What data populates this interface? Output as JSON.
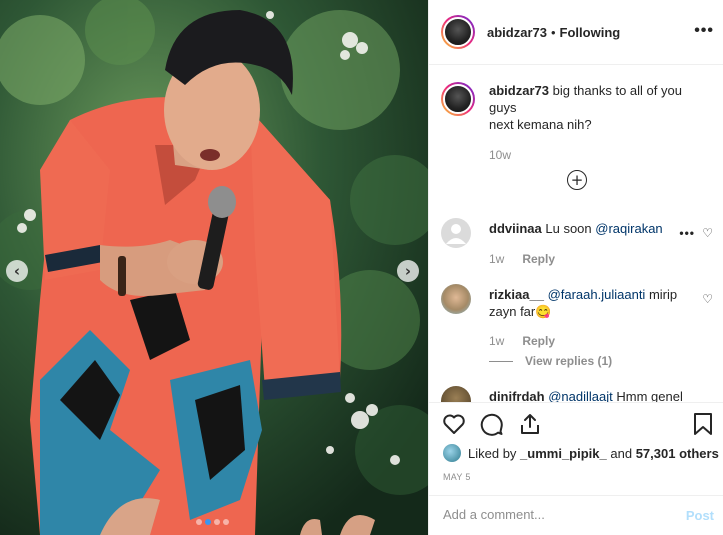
{
  "photo": {
    "carousel_prev_icon": "chevron-left-icon",
    "carousel_next_icon": "chevron-right-icon",
    "carousel": {
      "total": 4,
      "active": 2
    },
    "prev_glyph": "‹",
    "next_glyph": "›"
  },
  "header": {
    "username": "abidzar73",
    "separator": "•",
    "follow_status": "Following",
    "more_glyph": "•••"
  },
  "caption": {
    "username": "abidzar73",
    "text_line1": "big thanks to all of you guys",
    "text_line2": "next kemana nih?",
    "time": "10w",
    "load_more_glyph": "+"
  },
  "comments": [
    {
      "username": "ddviinaa",
      "text": "Lu soon",
      "mention": "@raqirakan",
      "time": "1w",
      "reply": "Reply",
      "avatar_color": "#dbdbdb"
    },
    {
      "username": "rizkiaa__",
      "text": "mirip zayn far😋",
      "mention": "@faraah.juliaanti",
      "time": "1w",
      "reply": "Reply",
      "view_replies": "View replies (1)",
      "avatar_color": "#c9b79a"
    },
    {
      "username": "dinifrdah",
      "mention": "@nadillaajt",
      "text": "Hmm genel",
      "avatar_color": "#6b5a3a"
    }
  ],
  "actions": {
    "liked_by_prefix": "Liked by",
    "liked_by_user": "_ummi_pipik_",
    "liked_by_and": "and",
    "liked_by_others": "57,301 others",
    "date": "MAY 5"
  },
  "add_comment": {
    "placeholder": "Add a comment...",
    "post_label": "Post"
  },
  "colors": {
    "link": "#003569",
    "muted": "#8e8e8e",
    "post_disabled": "#b2dffc",
    "carousel_active": "#3897f0"
  }
}
